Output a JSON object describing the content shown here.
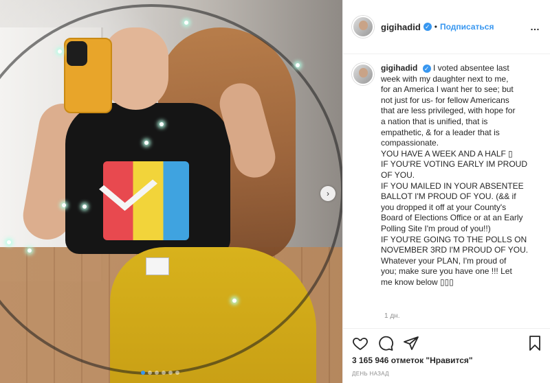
{
  "post": {
    "username": "gigihadid",
    "verified_badge": "✓",
    "separator": "•",
    "follow_label": "Подписаться",
    "more_icon": "…"
  },
  "caption": {
    "username": "gigihadid",
    "lines": [
      "I voted absentee last",
      "week with my daughter next to me,",
      "for an America I want her to see; but",
      "not just for us- for fellow Americans",
      "that are less privileged, with hope for",
      "a nation that is unified, that is",
      "empathetic, & for a leader that is",
      "compassionate.",
      "YOU HAVE A WEEK AND A HALF ▯",
      "IF YOU'RE VOTING EARLY IM PROUD",
      "OF YOU.",
      "IF YOU MAILED IN YOUR ABSENTEE",
      "BALLOT I'M PROUD OF YOU. (&& if",
      "you dropped it off at your County's",
      "Board of Elections Office or at an Early",
      "Polling Site I'm proud of you!!)",
      "IF YOU'RE GOING TO THE POLLS ON",
      "NOVEMBER 3RD I'M PROUD OF YOU.",
      "Whatever your PLAN, I'm proud of",
      "you; make sure you have one !!! Let",
      "me know below ▯▯▯"
    ],
    "time": "1 дн."
  },
  "footer": {
    "likes": "3 165 946 отметок \"Нравится\"",
    "date": "ДЕНЬ НАЗАД"
  },
  "icons": [
    "heart-icon",
    "comment-icon",
    "share-icon",
    "bookmark-icon",
    "next-arrow-icon"
  ],
  "colors": {
    "accent": "#3897f0",
    "text": "#262626",
    "muted": "#8e8e8e",
    "border": "#efefef"
  },
  "carousel": {
    "next_glyph": "›"
  }
}
